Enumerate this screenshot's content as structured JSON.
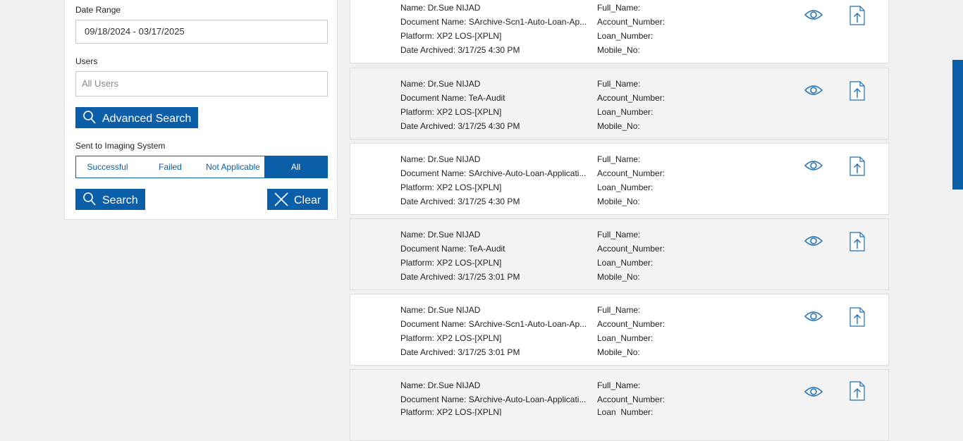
{
  "filters": {
    "date_range_label": "Date Range",
    "date_range_value": "09/18/2024 - 03/17/2025",
    "users_label": "Users",
    "users_placeholder": "All Users",
    "advanced_search_label": "Advanced Search",
    "imaging_label": "Sent to Imaging System",
    "imaging_options": [
      "Successful",
      "Failed",
      "Not Applicable",
      "All"
    ],
    "imaging_selected": "All",
    "search_label": "Search",
    "clear_label": "Clear"
  },
  "results": [
    {
      "name": "Name: Dr.Sue NIJAD",
      "document": "Document Name: SArchive-Scn1-Auto-Loan-Ap...",
      "platform": "Platform: XP2 LOS-[XPLN]",
      "date": "Date Archived: 3/17/25 4:30 PM",
      "full_name": "Full_Name:",
      "account_number": "Account_Number:",
      "loan_number": "Loan_Number:",
      "mobile_no": "Mobile_No:"
    },
    {
      "name": "Name: Dr.Sue NIJAD",
      "document": "Document Name: TeA-Audit",
      "platform": "Platform: XP2 LOS-[XPLN]",
      "date": "Date Archived: 3/17/25 4:30 PM",
      "full_name": "Full_Name:",
      "account_number": "Account_Number:",
      "loan_number": "Loan_Number:",
      "mobile_no": "Mobile_No:"
    },
    {
      "name": "Name: Dr.Sue NIJAD",
      "document": "Document Name: SArchive-Auto-Loan-Applicati...",
      "platform": "Platform: XP2 LOS-[XPLN]",
      "date": "Date Archived: 3/17/25 4:30 PM",
      "full_name": "Full_Name:",
      "account_number": "Account_Number:",
      "loan_number": "Loan_Number:",
      "mobile_no": "Mobile_No:"
    },
    {
      "name": "Name: Dr.Sue NIJAD",
      "document": "Document Name: TeA-Audit",
      "platform": "Platform: XP2 LOS-[XPLN]",
      "date": "Date Archived: 3/17/25 3:01 PM",
      "full_name": "Full_Name:",
      "account_number": "Account_Number:",
      "loan_number": "Loan_Number:",
      "mobile_no": "Mobile_No:"
    },
    {
      "name": "Name: Dr.Sue NIJAD",
      "document": "Document Name: SArchive-Scn1-Auto-Loan-Ap...",
      "platform": "Platform: XP2 LOS-[XPLN]",
      "date": "Date Archived: 3/17/25 3:01 PM",
      "full_name": "Full_Name:",
      "account_number": "Account_Number:",
      "loan_number": "Loan_Number:",
      "mobile_no": "Mobile_No:"
    },
    {
      "name": "Name: Dr.Sue NIJAD",
      "document": "Document Name: SArchive-Auto-Loan-Applicati...",
      "platform": "Platform: XP2 LOS-[XPLN]",
      "date": "",
      "full_name": "Full_Name:",
      "account_number": "Account_Number:",
      "loan_number": "Loan_Number:",
      "mobile_no": ""
    }
  ],
  "icons": {
    "view": "eye-icon",
    "upload": "upload-file-icon",
    "search": "search-icon",
    "clear": "close-icon"
  },
  "colors": {
    "accent": "#0b5ea8",
    "card_alt": "#f3f3f3"
  }
}
